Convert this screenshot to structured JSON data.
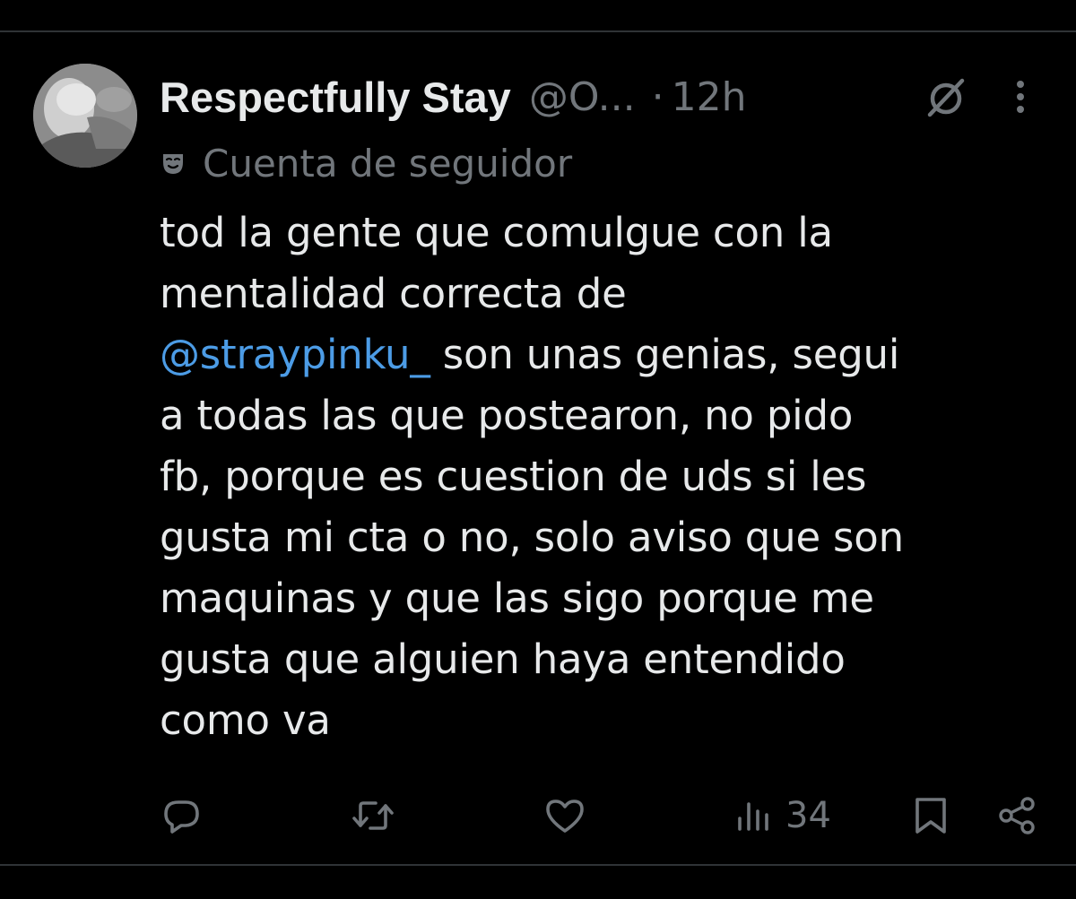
{
  "tweet": {
    "author": {
      "display_name": "Respectfully Stay",
      "handle": "@O...",
      "separator": "·",
      "time": "12h"
    },
    "account_label": {
      "icon": "mask-icon",
      "text": "Cuenta de seguidor"
    },
    "body_lines": [
      {
        "text": "tod la gente que comulgue con la"
      },
      {
        "text": "mentalidad correcta de"
      },
      {
        "mention": "@straypinku_",
        "text": " son unas genias, segui"
      },
      {
        "text": "a todas las que postearon, no pido"
      },
      {
        "text": "fb, porque es cuestion de uds si les"
      },
      {
        "text": "gusta mi cta o no, solo aviso que son"
      },
      {
        "text": "maquinas y que las sigo porque me"
      },
      {
        "text": "gusta que alguien haya entendido"
      },
      {
        "text": "como va"
      }
    ],
    "actions": {
      "reply_icon": "reply-icon",
      "retweet_icon": "retweet-icon",
      "like_icon": "heart-icon",
      "views_icon": "views-icon",
      "views_count": "34",
      "bookmark_icon": "bookmark-icon",
      "share_icon": "share-icon"
    }
  },
  "colors": {
    "background": "#000000",
    "text_primary": "#e7e9ea",
    "text_secondary": "#71767b",
    "mention": "#4c9ce6",
    "divider": "#2f3336"
  }
}
